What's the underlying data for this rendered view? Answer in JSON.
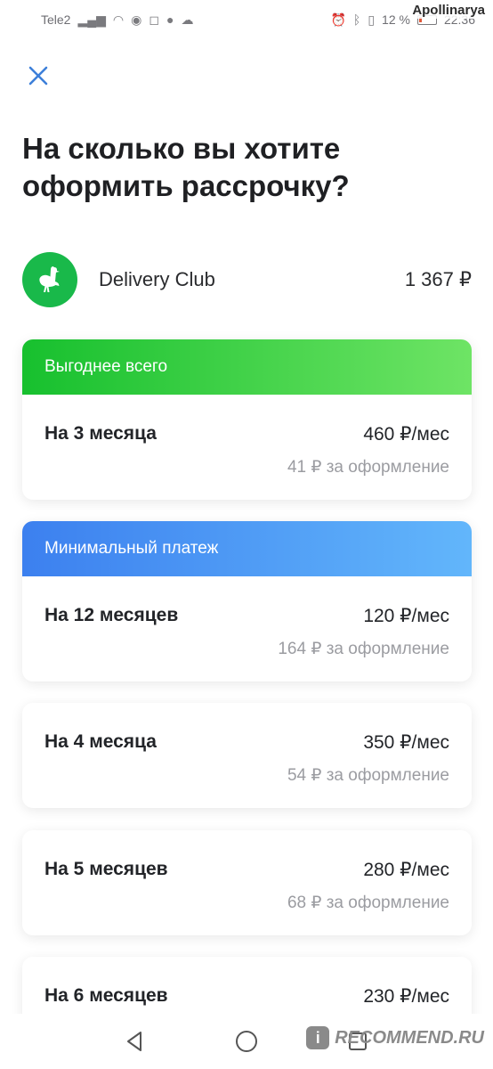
{
  "status_bar": {
    "carrier": "Tele2",
    "battery_percent": "12 %",
    "time": "22:36"
  },
  "watermark": {
    "user": "Apollinarya",
    "site": "RECOMMEND.RU",
    "badge": "i"
  },
  "header": {
    "title": "На сколько вы хотите оформить рассрочку?"
  },
  "merchant": {
    "name": "Delivery Club",
    "amount": "1 367 ₽",
    "logo_color": "#19b94a"
  },
  "plans": [
    {
      "badge": "Выгоднее всего",
      "term": "На 3 месяца",
      "price": "460 ₽/мес",
      "fee": "41 ₽ за оформление"
    },
    {
      "badge": "Минимальный платеж",
      "term": "На 12 месяцев",
      "price": "120 ₽/мес",
      "fee": "164 ₽ за оформление"
    },
    {
      "term": "На 4 месяца",
      "price": "350 ₽/мес",
      "fee": "54 ₽ за оформление"
    },
    {
      "term": "На 5 месяцев",
      "price": "280 ₽/мес",
      "fee": "68 ₽ за оформление"
    },
    {
      "term": "На 6 месяцев",
      "price": "230 ₽/мес"
    }
  ],
  "colors": {
    "best_badge_start": "#17c02e",
    "best_badge_end": "#6ee465",
    "min_badge_start": "#3c80ef",
    "min_badge_end": "#62b6fb",
    "close_icon": "#3d7fd9",
    "fee_text": "#9b9ca1"
  },
  "icons": [
    "close-icon",
    "ostrich-logo-icon",
    "back-icon",
    "home-icon",
    "recents-icon"
  ]
}
